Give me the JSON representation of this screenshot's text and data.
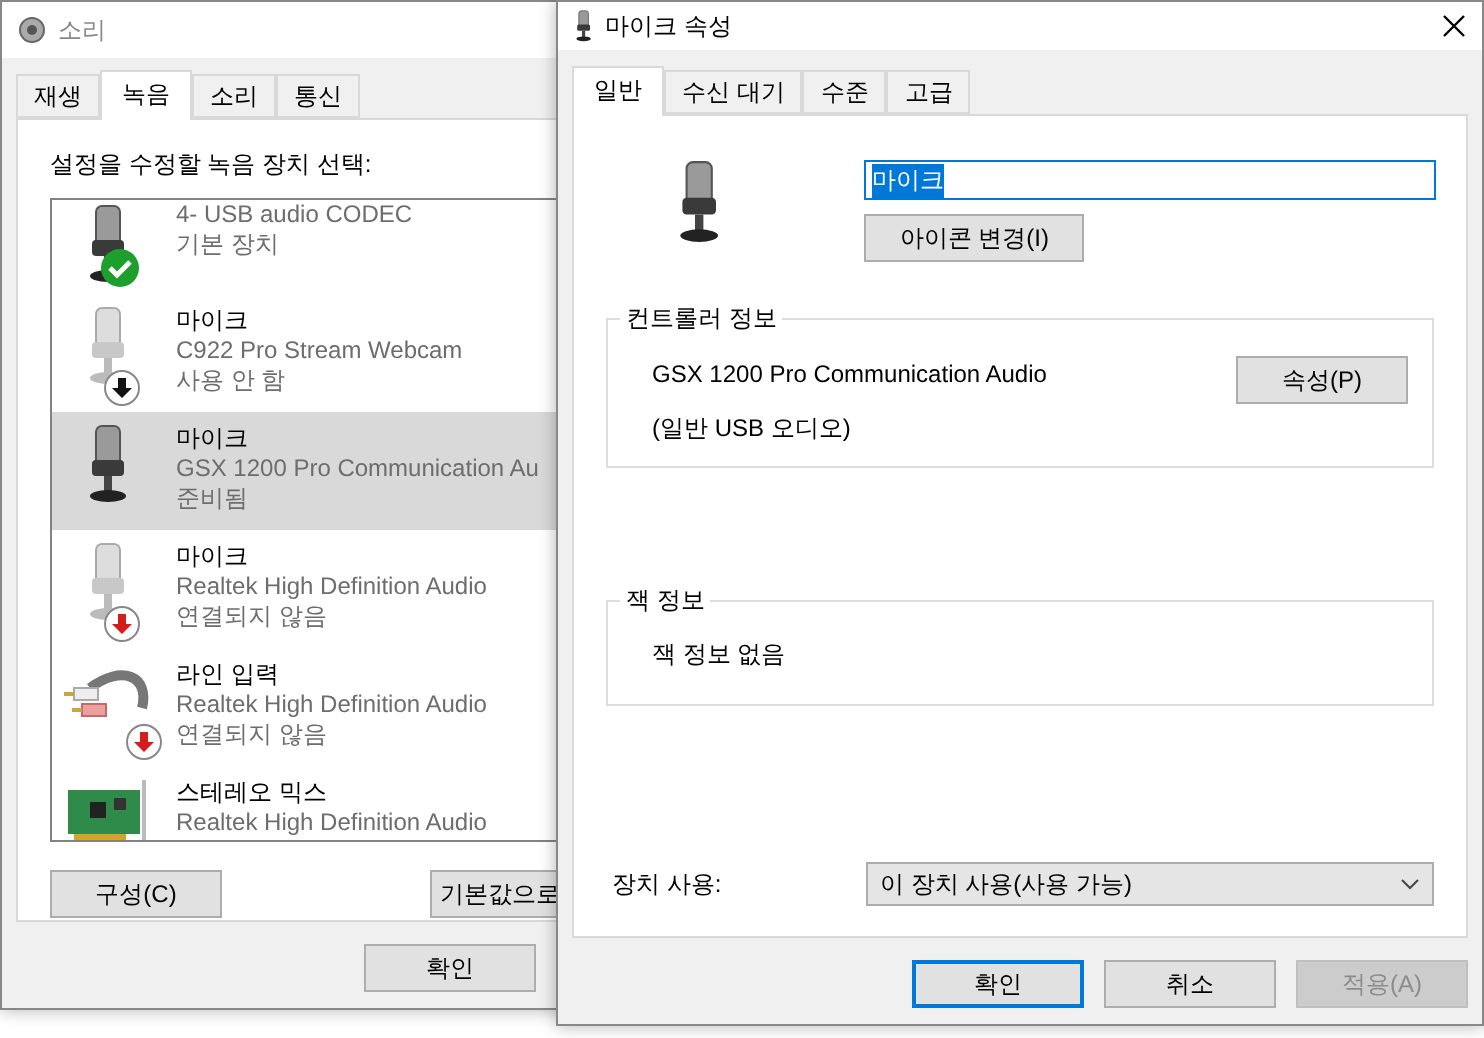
{
  "sound_window": {
    "title": "소리",
    "tabs": [
      {
        "label": "재생",
        "selected": false
      },
      {
        "label": "녹음",
        "selected": true
      },
      {
        "label": "소리",
        "selected": false
      },
      {
        "label": "통신",
        "selected": false
      }
    ],
    "prompt": "설정을 수정할 녹음 장치 선택:",
    "devices": [
      {
        "kind": "microphone",
        "is_default": true,
        "disabled": false,
        "unplugged": false,
        "device": "4- USB audio CODEC",
        "status": "기본 장치",
        "selected": false
      },
      {
        "name": "마이크",
        "kind": "microphone",
        "is_default": false,
        "disabled": true,
        "unplugged": false,
        "device": "C922 Pro Stream Webcam",
        "status": "사용 안 함",
        "selected": false
      },
      {
        "name": "마이크",
        "kind": "microphone",
        "is_default": false,
        "disabled": false,
        "unplugged": false,
        "device": "GSX 1200 Pro Communication Au",
        "status": "준비됨",
        "selected": true
      },
      {
        "name": "마이크",
        "kind": "microphone",
        "is_default": false,
        "disabled": false,
        "unplugged": true,
        "device": "Realtek High Definition Audio",
        "status": "연결되지 않음",
        "selected": false
      },
      {
        "name": "라인 입력",
        "kind": "line",
        "is_default": false,
        "disabled": false,
        "unplugged": true,
        "device": "Realtek High Definition Audio",
        "status": "연결되지 않음",
        "selected": false
      },
      {
        "name": "스테레오 믹스",
        "kind": "mixer",
        "is_default": false,
        "disabled": false,
        "unplugged": false,
        "device": "Realtek High Definition Audio",
        "selected": false
      }
    ],
    "buttons": [
      "구성(C)",
      "기본값으로"
    ],
    "ok_button": "확인"
  },
  "properties_window": {
    "title": "마이크 속성",
    "tabs": [
      {
        "label": "일반",
        "selected": true
      },
      {
        "label": "수신 대기",
        "selected": false
      },
      {
        "label": "수준",
        "selected": false
      },
      {
        "label": "고급",
        "selected": false
      }
    ],
    "name_field": {
      "value": "마이크"
    },
    "change_icon_button": "아이콘 변경(I)",
    "controller_info": {
      "title": "컨트롤러 정보",
      "controller": "GSX 1200 Pro Communication Audio",
      "driver": "(일반 USB 오디오)",
      "button": "속성(P)"
    },
    "jack_info": {
      "title": "잭 정보",
      "text": "잭 정보 없음"
    },
    "device_usage": {
      "label": "장치 사용:",
      "value": "이 장치 사용(사용 가능)"
    },
    "buttons": [
      {
        "label": "확인",
        "kind": "default",
        "disabled": false
      },
      {
        "label": "취소",
        "kind": "normal",
        "disabled": false
      },
      {
        "label": "적용(A)",
        "kind": "normal",
        "disabled": true
      }
    ]
  }
}
